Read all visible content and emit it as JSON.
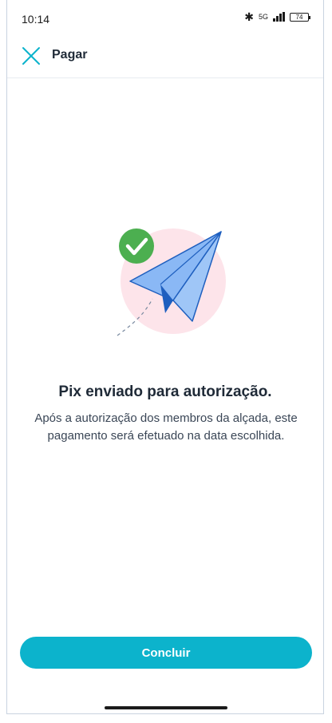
{
  "status_bar": {
    "time": "10:14",
    "network": "5G",
    "battery": "74"
  },
  "header": {
    "title": "Pagar",
    "close_icon": "close-icon"
  },
  "content": {
    "title": "Pix enviado para autorização.",
    "message": "Após a autorização dos membros da alçada, este pagamento será efetuado na data escolhida."
  },
  "actions": {
    "primary_label": "Concluir"
  },
  "colors": {
    "accent": "#0cb3cc",
    "success": "#4caf50",
    "illustration_bg": "#fde4ea",
    "plane": "#8ab8f5"
  }
}
